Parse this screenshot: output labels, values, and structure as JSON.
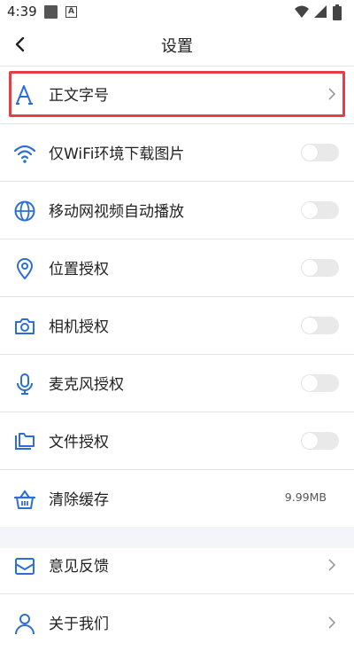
{
  "status": {
    "time": "4:39",
    "notif_icon_text": "A"
  },
  "header": {
    "title": "设置"
  },
  "rows": [
    {
      "label": "正文字号",
      "icon": "font-size-icon",
      "control": "chevron"
    },
    {
      "label": "仅WiFi环境下载图片",
      "icon": "wifi-icon",
      "control": "toggle",
      "on": false
    },
    {
      "label": "移动网视频自动播放",
      "icon": "globe-icon",
      "control": "toggle",
      "on": false
    },
    {
      "label": "位置授权",
      "icon": "location-pin-icon",
      "control": "toggle",
      "on": false
    },
    {
      "label": "相机授权",
      "icon": "camera-icon",
      "control": "toggle",
      "on": false
    },
    {
      "label": "麦克风授权",
      "icon": "microphone-icon",
      "control": "toggle",
      "on": false
    },
    {
      "label": "文件授权",
      "icon": "folder-icon",
      "control": "toggle",
      "on": false
    },
    {
      "label": "清除缓存",
      "icon": "basket-icon",
      "control": "value",
      "value": "9.99MB"
    },
    {
      "label": "意见反馈",
      "icon": "mail-icon",
      "control": "chevron"
    },
    {
      "label": "关于我们",
      "icon": "user-icon",
      "control": "chevron"
    }
  ],
  "colors": {
    "accent": "#2b6fd6",
    "highlight": "#e53e46",
    "divider": "#e3e3e3",
    "gap": "#f4f5f8"
  }
}
